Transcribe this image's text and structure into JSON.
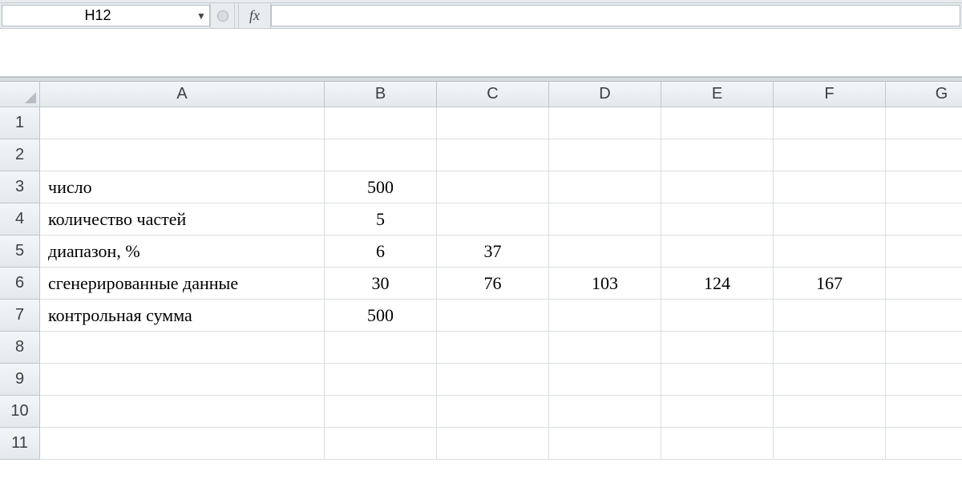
{
  "formula_bar": {
    "name_box": "H12",
    "fx_label": "fx",
    "formula_value": ""
  },
  "columns": [
    "A",
    "B",
    "C",
    "D",
    "E",
    "F",
    "G"
  ],
  "row_numbers": [
    "1",
    "2",
    "3",
    "4",
    "5",
    "6",
    "7",
    "8",
    "9",
    "10",
    "11"
  ],
  "cells": {
    "A3": "число",
    "B3": "500",
    "A4": "количество частей",
    "B4": "5",
    "A5": "диапазон, %",
    "B5": "6",
    "C5": "37",
    "A6": "сгенерированные данные",
    "B6": "30",
    "C6": "76",
    "D6": "103",
    "E6": "124",
    "F6": "167",
    "A7": "контрольная сумма",
    "B7": "500"
  }
}
